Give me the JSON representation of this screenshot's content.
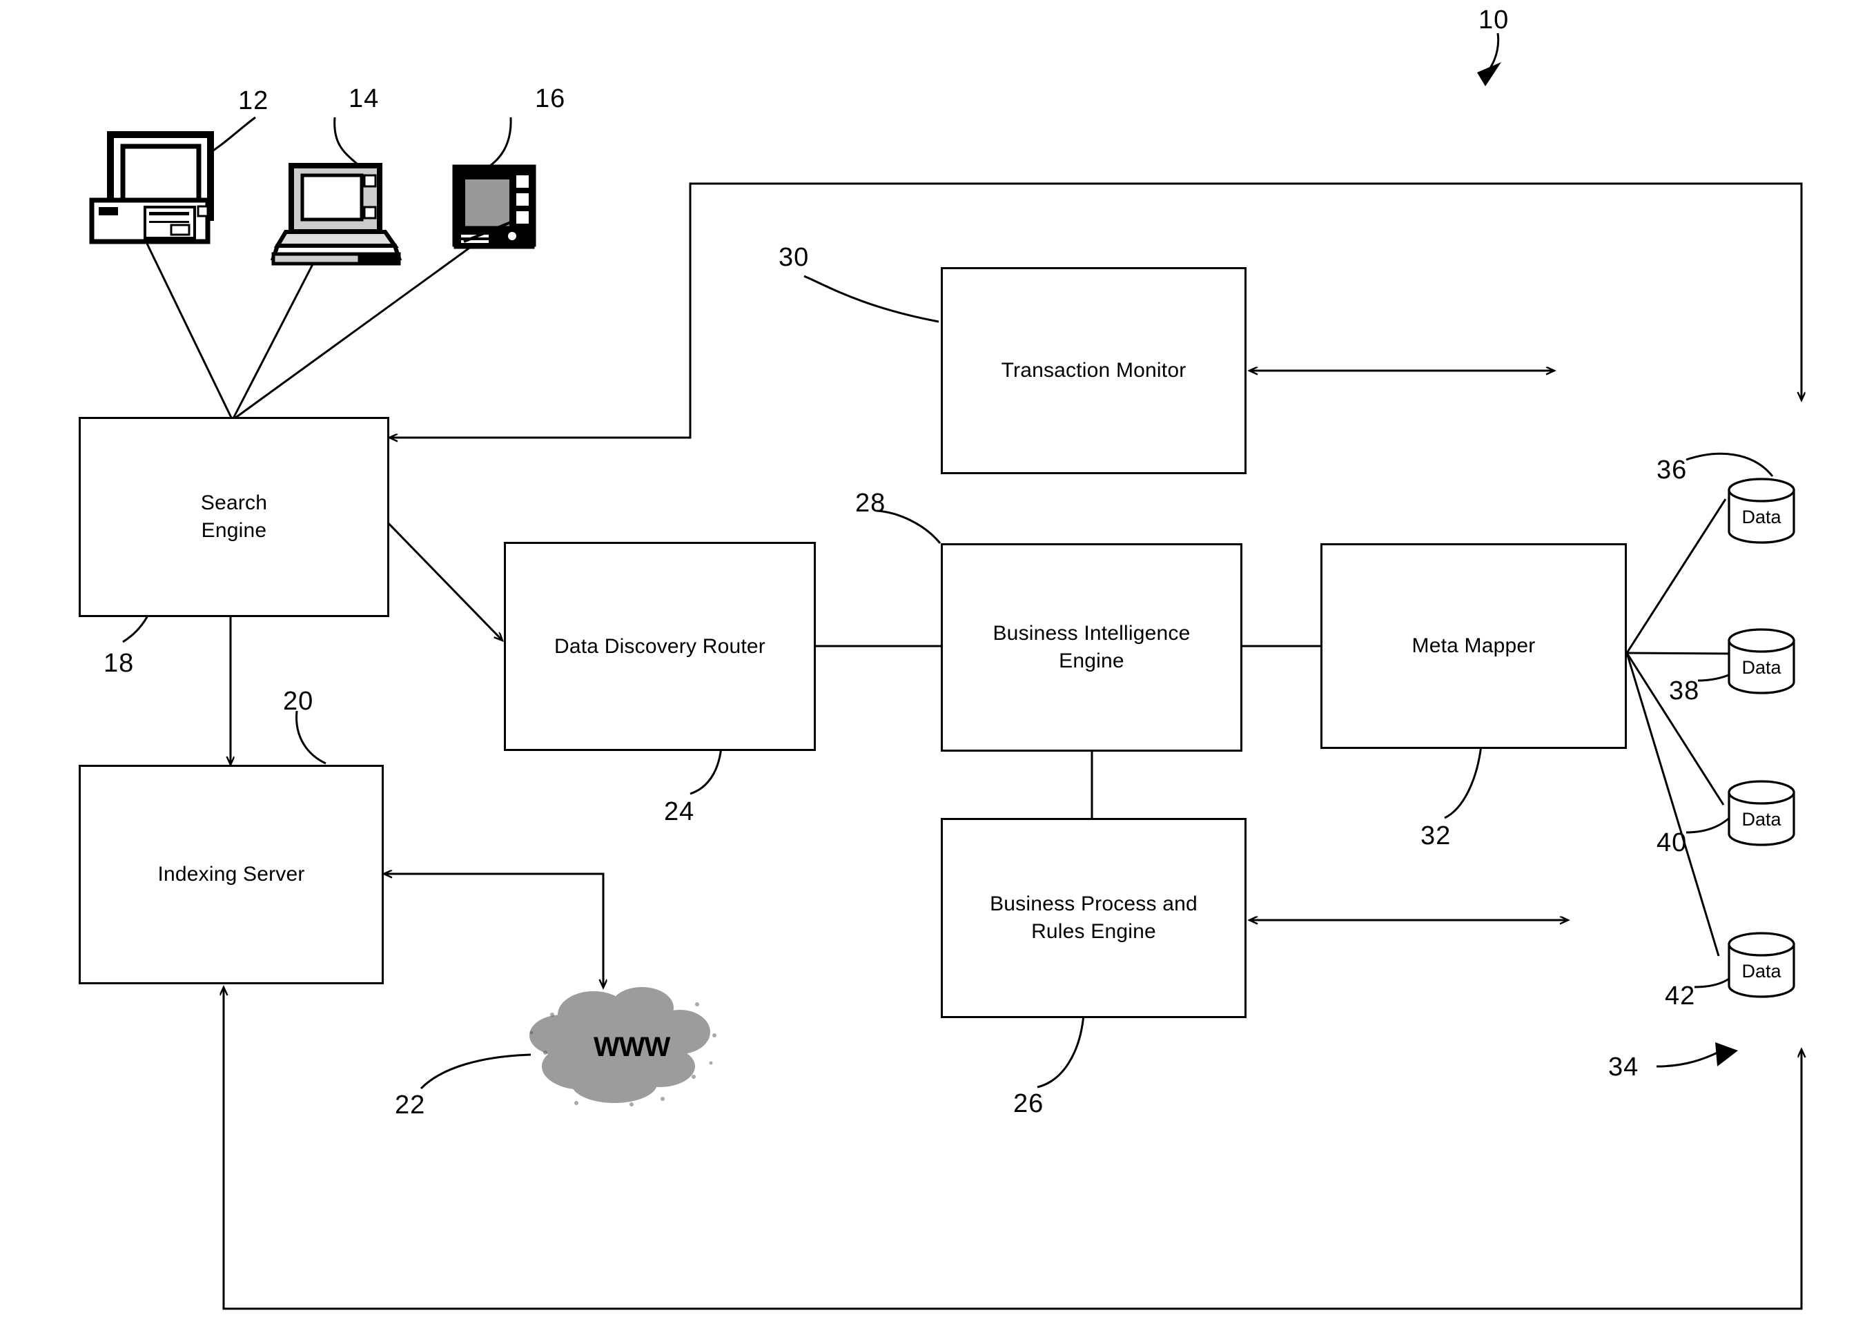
{
  "figure": {
    "system_ref": "10",
    "type": "patent-block-diagram"
  },
  "nodes": [
    {
      "id": "search-engine",
      "label": "Search\nEngine",
      "ref": "18"
    },
    {
      "id": "indexing-server",
      "label": "Indexing Server",
      "ref": "20"
    },
    {
      "id": "data-discovery",
      "label": "Data Discovery Router",
      "ref": "24"
    },
    {
      "id": "business-intel",
      "label": "Business Intelligence\nEngine",
      "ref": "28"
    },
    {
      "id": "meta-mapper",
      "label": "Meta Mapper",
      "ref": "32"
    },
    {
      "id": "transaction-mon",
      "label": "Transaction Monitor",
      "ref": "30"
    },
    {
      "id": "business-rules",
      "label": "Business Process and\nRules Engine",
      "ref": "26"
    }
  ],
  "node_labels": {
    "search_engine_line1": "Search",
    "search_engine_line2": "Engine",
    "indexing_server": "Indexing Server",
    "data_discovery_router": "Data Discovery Router",
    "business_intelligence_line1": "Business Intelligence",
    "business_intelligence_line2": "Engine",
    "meta_mapper": "Meta Mapper",
    "transaction_monitor": "Transaction Monitor",
    "business_rules_line1": "Business Process and",
    "business_rules_line2": "Rules Engine"
  },
  "devices": [
    {
      "id": "desktop-computer",
      "icon": "desktop-computer-icon",
      "ref": "12"
    },
    {
      "id": "laptop-computer",
      "icon": "laptop-computer-icon",
      "ref": "14"
    },
    {
      "id": "handheld-device",
      "icon": "pda-handheld-icon",
      "ref": "16"
    }
  ],
  "cloud": {
    "label": "WWW",
    "ref": "22",
    "icon": "internet-cloud-icon"
  },
  "datastores": [
    {
      "label": "Data",
      "ref": "36"
    },
    {
      "label": "Data",
      "ref": "38"
    },
    {
      "label": "Data",
      "ref": "40"
    },
    {
      "label": "Data",
      "ref": "42"
    }
  ],
  "refs": {
    "system": "10",
    "desktop": "12",
    "laptop": "14",
    "handheld": "16",
    "search_engine": "18",
    "indexing_server": "20",
    "www_cloud": "22",
    "data_discovery_router": "24",
    "business_rules_engine": "26",
    "business_intelligence_engine": "28",
    "transaction_monitor": "30",
    "meta_mapper": "32",
    "data_sources_group": "34",
    "datastore_1": "36",
    "datastore_2": "38",
    "datastore_3": "40",
    "datastore_4": "42"
  },
  "colors": {
    "line": "#000000",
    "background": "#ffffff",
    "text": "#000000"
  }
}
